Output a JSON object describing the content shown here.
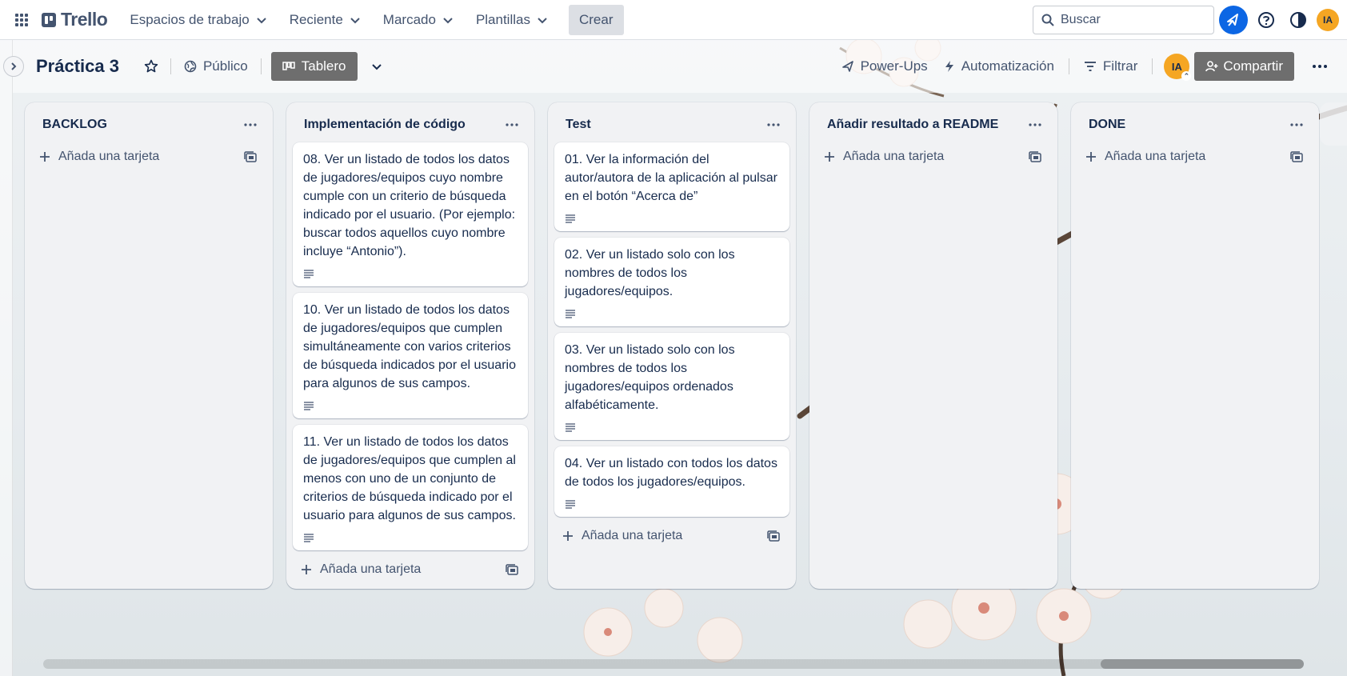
{
  "topbar": {
    "logo_text": "Trello",
    "nav": [
      {
        "label": "Espacios de trabajo"
      },
      {
        "label": "Reciente"
      },
      {
        "label": "Marcado"
      },
      {
        "label": "Plantillas"
      }
    ],
    "create_label": "Crear",
    "search_placeholder": "Buscar",
    "avatar_initials": "IA"
  },
  "board": {
    "title": "Práctica 3",
    "visibility_label": "Público",
    "view_label": "Tablero",
    "powerups_label": "Power-Ups",
    "automation_label": "Automatización",
    "filter_label": "Filtrar",
    "member_initials": "IA",
    "share_label": "Compartir"
  },
  "lists": [
    {
      "title": "BACKLOG",
      "cards": [],
      "add_card_label": "Añada una tarjeta"
    },
    {
      "title": "Implementación de código",
      "cards": [
        {
          "text": "08. Ver un listado de todos los datos de jugadores/equipos cuyo nombre cumple con un criterio de búsqueda indicado por el usuario. (Por ejemplo: buscar todos aquellos cuyo nombre incluye “Antonio”)."
        },
        {
          "text": "10. Ver un listado de todos los datos de jugadores/equipos que cumplen simultáneamente con varios criterios de búsqueda indicados por el usuario para algunos de sus campos."
        },
        {
          "text": "11. Ver un listado de todos los datos de jugadores/equipos que cumplen al menos con uno de un conjunto de criterios de búsqueda indicado por el usuario para algunos de sus campos."
        }
      ],
      "add_card_label": "Añada una tarjeta"
    },
    {
      "title": "Test",
      "cards": [
        {
          "text": "01. Ver la información del autor/autora de la aplicación al pulsar en el botón “Acerca de”"
        },
        {
          "text": "02. Ver un listado solo con los nombres de todos los jugadores/equipos."
        },
        {
          "text": "03. Ver un listado solo con los nombres de todos los jugadores/equipos ordenados alfabéticamente."
        },
        {
          "text": "04. Ver un listado con todos los datos de todos los jugadores/equipos."
        }
      ],
      "add_card_label": "Añada una tarjeta"
    },
    {
      "title": "Añadir resultado a README",
      "cards": [],
      "add_card_label": "Añada una tarjeta"
    },
    {
      "title": "DONE",
      "cards": [],
      "add_card_label": "Añada una tarjeta"
    }
  ],
  "colors": {
    "accent": "#0c66e4",
    "avatar": "#f5a623",
    "view_button": "#6e6e6e"
  }
}
